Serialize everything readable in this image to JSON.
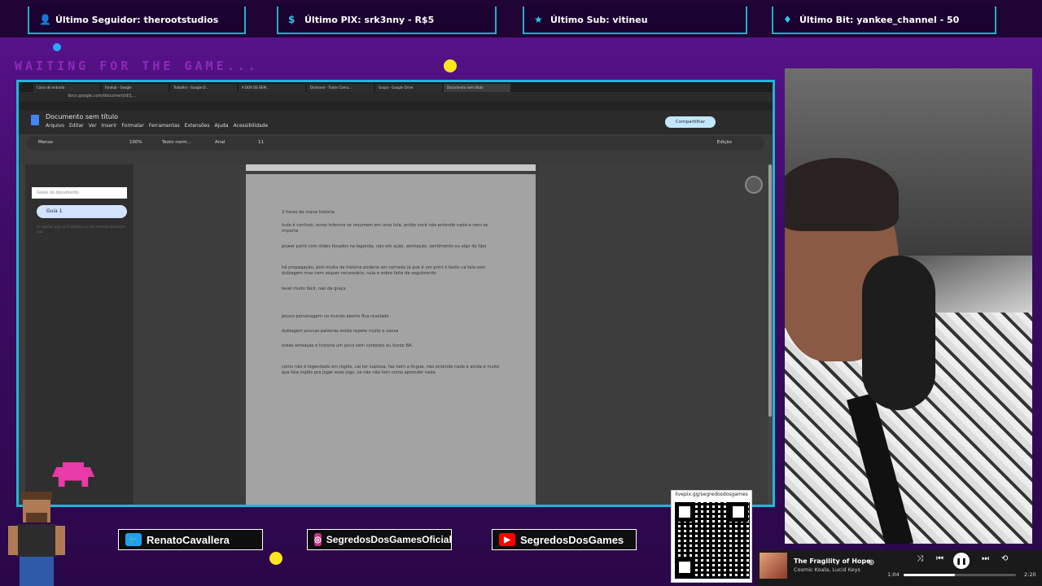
{
  "overlay": {
    "top_items": [
      {
        "icon": "person-icon",
        "label": "Último Seguidor: therootstudios"
      },
      {
        "icon": "dollar-icon",
        "label": "Último PIX: srk3nny - R$5"
      },
      {
        "icon": "star-icon",
        "label": "Último Sub: vitineu"
      },
      {
        "icon": "diamond-icon",
        "label": "Último Bit: yankee_channel - 50"
      }
    ],
    "waiting_text": "WAITING FOR THE GAME..."
  },
  "browser": {
    "tabs": [
      "Caixa de entrada",
      "Fandub - Google",
      "Trabalho - Google D...",
      "A DOR DE BEM...",
      "Diamond - Trailer Comu...",
      "Grupo - Google Drive",
      "Documento sem título"
    ],
    "url": "docs.google.com/document/d/1..."
  },
  "docs": {
    "title": "Documento sem título",
    "menu": [
      "Arquivo",
      "Editar",
      "Ver",
      "Inserir",
      "Formatar",
      "Ferramentas",
      "Extensões",
      "Ajuda",
      "Acessibilidade"
    ],
    "share_label": "Compartilhar",
    "toolbar": {
      "menus": "Menus",
      "zoom": "100%",
      "style": "Texto norm...",
      "font": "Arial",
      "size": "11",
      "edit_mode": "Edição"
    },
    "panel": {
      "summary_label": "Guias no documento",
      "guide_label": "Guia 1",
      "hint": "As opções que você adiciona ao documento aparecem aqui"
    },
    "lines": [
      "2 horas de mana história",
      "tudo é confuso, ocres infernos se resumem em uma luta, então você não entende nada e nem se importa",
      "power point com slides focados na legenda, não em ação, animação, sentimento ou algo do tipo",
      "há propagação, pois muita da história poderia ser contada já que é um print e texto na tela sem dublagem mas nem sequer necessário, nula e sobre falta de seguimento",
      "level muito fácil, não da graça",
      "pouco personagem no mundo aberto fica revelado",
      "dublagem poucas palavras então repete muito e cansa",
      "todas ameaças e história um poco sem contexto ou fundo BA",
      "como não é legendado em inglês, vai ter suplesa, faz nem a língua, não entende nada e ainda é muito que fala inglês pra jogar esse jogo, se não não tem como aprender nada"
    ]
  },
  "social": {
    "twitter": "RenatoCavallera",
    "instagram": "SegredosDosGamesOficial",
    "youtube": "SegredosDosGames"
  },
  "qr": {
    "url": "livepix.gg/segredosdosgames"
  },
  "music": {
    "title": "The Fragility of Hope",
    "artist": "Cosmic Koala, Lucid Keys",
    "elapsed": "1:04",
    "total": "2:20",
    "progress": 0.46
  },
  "colors": {
    "accent": "#1fb0c8",
    "purple_bg": "#3d0c66",
    "yellow": "#ffe51c",
    "pink": "#e83aa8"
  }
}
